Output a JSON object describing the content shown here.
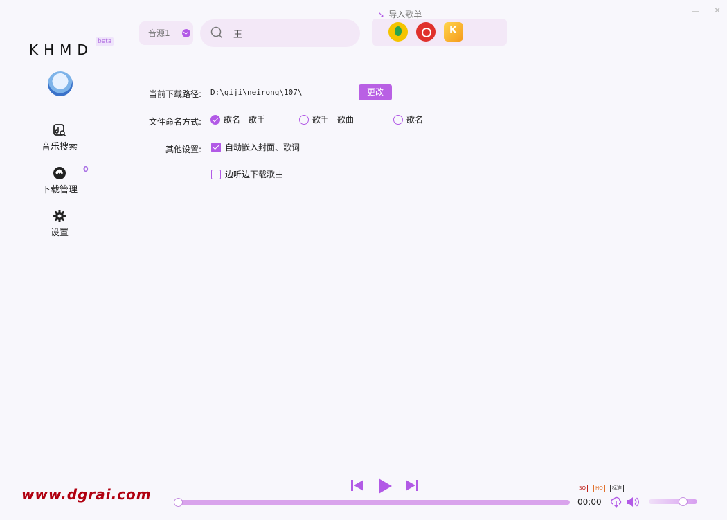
{
  "app": {
    "logo": "KHMD",
    "beta": "beta"
  },
  "sidebar": {
    "items": [
      {
        "label": "音乐搜索",
        "icon": "music-search-icon"
      },
      {
        "label": "下载管理",
        "icon": "download-cloud-icon",
        "count": "0"
      },
      {
        "label": "设置",
        "icon": "gear-icon"
      }
    ]
  },
  "topbar": {
    "source": "音源1",
    "search_value": "王",
    "import_label": "导入歌单",
    "platforms": [
      "qq-music-icon",
      "netease-music-icon",
      "kuwo-music-icon"
    ]
  },
  "settings": {
    "path_label": "当前下载路径:",
    "path_value": "D:\\qiji\\neirong\\107\\",
    "change_label": "更改",
    "naming_label": "文件命名方式:",
    "naming_options": [
      "歌名 - 歌手",
      "歌手 - 歌曲",
      "歌名"
    ],
    "naming_selected": 0,
    "other_label": "其他设置:",
    "other_options": [
      {
        "label": "自动嵌入封面、歌词",
        "checked": true
      },
      {
        "label": "边听边下载歌曲",
        "checked": false
      }
    ]
  },
  "player": {
    "time": "00:00",
    "progress": 0,
    "volume": 0.7,
    "quality": [
      "SQ",
      "HQ",
      "标准"
    ]
  },
  "watermark": "www.dgrai.com",
  "colors": {
    "accent": "#b25ae6",
    "bg": "#f8f7fc",
    "panel": "#f3e8f7"
  }
}
